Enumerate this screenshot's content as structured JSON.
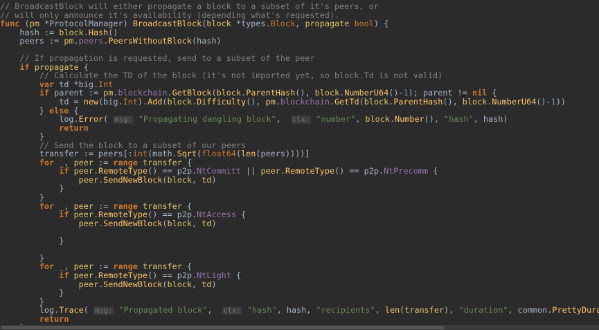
{
  "editor": {
    "language": "go",
    "token_colors": {
      "comment": "#808080",
      "keyword": "#cc7832",
      "function": "#ffc66d",
      "parameter": "#e0c46c",
      "field": "#9876aa",
      "string": "#6a8759",
      "number": "#6897bb",
      "default": "#a9b7c6",
      "background": "#2b2b2b"
    },
    "lines": [
      [
        {
          "t": "com",
          "v": "// BroadcastBlock will either propagate a block to a subset of it's peers, or"
        }
      ],
      [
        {
          "t": "com",
          "v": "// will only announce it's availability (depending what's requested)."
        }
      ],
      [
        {
          "t": "kw",
          "v": "func"
        },
        {
          "t": "op",
          "v": " ("
        },
        {
          "t": "param",
          "v": "pm"
        },
        {
          "t": "op",
          "v": " *ProtocolManager) "
        },
        {
          "t": "fn",
          "v": "BroadcastBlock"
        },
        {
          "t": "op",
          "v": "("
        },
        {
          "t": "param",
          "v": "block"
        },
        {
          "t": "op",
          "v": " *types."
        },
        {
          "t": "type",
          "v": "Block"
        },
        {
          "t": "op",
          "v": ", "
        },
        {
          "t": "param",
          "v": "propagate"
        },
        {
          "t": "op",
          "v": " "
        },
        {
          "t": "type",
          "v": "bool"
        },
        {
          "t": "op",
          "v": ") {"
        }
      ],
      [
        {
          "t": "op",
          "v": "    hash := "
        },
        {
          "t": "param",
          "v": "block"
        },
        {
          "t": "op",
          "v": "."
        },
        {
          "t": "fn",
          "v": "Hash"
        },
        {
          "t": "op",
          "v": "()"
        }
      ],
      [
        {
          "t": "op",
          "v": "    peers := "
        },
        {
          "t": "param",
          "v": "pm"
        },
        {
          "t": "op",
          "v": "."
        },
        {
          "t": "field",
          "v": "peers"
        },
        {
          "t": "op",
          "v": "."
        },
        {
          "t": "fn",
          "v": "PeersWithoutBlock"
        },
        {
          "t": "op",
          "v": "(hash)"
        }
      ],
      [
        {
          "t": "op",
          "v": ""
        }
      ],
      [
        {
          "t": "com",
          "v": "    // If propagation is requested, send to a subset of the peer"
        }
      ],
      [
        {
          "t": "op",
          "v": "    "
        },
        {
          "t": "kw",
          "v": "if"
        },
        {
          "t": "op",
          "v": " "
        },
        {
          "t": "param",
          "v": "propagate"
        },
        {
          "t": "op",
          "v": " {"
        }
      ],
      [
        {
          "t": "com",
          "v": "        // Calculate the TD of the block (it's not imported yet, so block.Td is not valid)"
        }
      ],
      [
        {
          "t": "op",
          "v": "        "
        },
        {
          "t": "kw",
          "v": "var"
        },
        {
          "t": "op",
          "v": " td *big."
        },
        {
          "t": "type",
          "v": "Int"
        }
      ],
      [
        {
          "t": "op",
          "v": "        "
        },
        {
          "t": "kw",
          "v": "if"
        },
        {
          "t": "op",
          "v": " parent := "
        },
        {
          "t": "param",
          "v": "pm"
        },
        {
          "t": "op",
          "v": "."
        },
        {
          "t": "field",
          "v": "blockchain"
        },
        {
          "t": "op",
          "v": "."
        },
        {
          "t": "fn",
          "v": "GetBlock"
        },
        {
          "t": "op",
          "v": "("
        },
        {
          "t": "param",
          "v": "block"
        },
        {
          "t": "op",
          "v": "."
        },
        {
          "t": "fn",
          "v": "ParentHash"
        },
        {
          "t": "op",
          "v": "(), "
        },
        {
          "t": "param",
          "v": "block"
        },
        {
          "t": "op",
          "v": "."
        },
        {
          "t": "fn",
          "v": "NumberU64"
        },
        {
          "t": "op",
          "v": "()-"
        },
        {
          "t": "num",
          "v": "1"
        },
        {
          "t": "op",
          "v": "); parent != "
        },
        {
          "t": "kw",
          "v": "nil"
        },
        {
          "t": "op",
          "v": " {"
        }
      ],
      [
        {
          "t": "op",
          "v": "            td = "
        },
        {
          "t": "fn",
          "v": "new"
        },
        {
          "t": "op",
          "v": "(big."
        },
        {
          "t": "type",
          "v": "Int"
        },
        {
          "t": "op",
          "v": ")."
        },
        {
          "t": "fn",
          "v": "Add"
        },
        {
          "t": "op",
          "v": "("
        },
        {
          "t": "param",
          "v": "block"
        },
        {
          "t": "op",
          "v": "."
        },
        {
          "t": "fn",
          "v": "Difficulty"
        },
        {
          "t": "op",
          "v": "(), "
        },
        {
          "t": "param",
          "v": "pm"
        },
        {
          "t": "op",
          "v": "."
        },
        {
          "t": "field",
          "v": "blockchain"
        },
        {
          "t": "op",
          "v": "."
        },
        {
          "t": "fn",
          "v": "GetTd"
        },
        {
          "t": "op",
          "v": "("
        },
        {
          "t": "param",
          "v": "block"
        },
        {
          "t": "op",
          "v": "."
        },
        {
          "t": "fn",
          "v": "ParentHash"
        },
        {
          "t": "op",
          "v": "(), "
        },
        {
          "t": "param",
          "v": "block"
        },
        {
          "t": "op",
          "v": "."
        },
        {
          "t": "fn",
          "v": "NumberU64"
        },
        {
          "t": "op",
          "v": "()-"
        },
        {
          "t": "num",
          "v": "1"
        },
        {
          "t": "op",
          "v": "))"
        }
      ],
      [
        {
          "t": "op",
          "v": "        } "
        },
        {
          "t": "kw",
          "v": "else"
        },
        {
          "t": "op",
          "v": " {"
        }
      ],
      [
        {
          "t": "op",
          "v": "            log."
        },
        {
          "t": "fn",
          "v": "Error"
        },
        {
          "t": "op",
          "v": "( "
        },
        {
          "t": "hint",
          "v": "msg:"
        },
        {
          "t": "op",
          "v": " "
        },
        {
          "t": "str",
          "v": "\"Propagating dangling block\""
        },
        {
          "t": "op",
          "v": ",  "
        },
        {
          "t": "hint",
          "v": "ctx:"
        },
        {
          "t": "op",
          "v": " "
        },
        {
          "t": "str",
          "v": "\"number\""
        },
        {
          "t": "op",
          "v": ", "
        },
        {
          "t": "param",
          "v": "block"
        },
        {
          "t": "op",
          "v": "."
        },
        {
          "t": "fn",
          "v": "Number"
        },
        {
          "t": "op",
          "v": "(), "
        },
        {
          "t": "str",
          "v": "\"hash\""
        },
        {
          "t": "op",
          "v": ", hash)"
        }
      ],
      [
        {
          "t": "op",
          "v": "            "
        },
        {
          "t": "kw",
          "v": "return"
        }
      ],
      [
        {
          "t": "op",
          "v": "        }"
        }
      ],
      [
        {
          "t": "com",
          "v": "        // Send the block to a subset of our peers"
        }
      ],
      [
        {
          "t": "op",
          "v": "        transfer := peers[:"
        },
        {
          "t": "type",
          "v": "int"
        },
        {
          "t": "op",
          "v": "(math."
        },
        {
          "t": "fn",
          "v": "Sqrt"
        },
        {
          "t": "op",
          "v": "("
        },
        {
          "t": "type",
          "v": "float64"
        },
        {
          "t": "op",
          "v": "("
        },
        {
          "t": "fn",
          "v": "len"
        },
        {
          "t": "op",
          "v": "(peers))))]"
        }
      ],
      [
        {
          "t": "op",
          "v": "        "
        },
        {
          "t": "kw",
          "v": "for"
        },
        {
          "t": "op",
          "v": " _, "
        },
        {
          "t": "param",
          "v": "peer"
        },
        {
          "t": "op",
          "v": " := "
        },
        {
          "t": "kw",
          "v": "range"
        },
        {
          "t": "op",
          "v": " "
        },
        {
          "t": "param",
          "v": "transfer"
        },
        {
          "t": "op",
          "v": " {"
        }
      ],
      [
        {
          "t": "op",
          "v": "            "
        },
        {
          "t": "kw",
          "v": "if"
        },
        {
          "t": "op",
          "v": " "
        },
        {
          "t": "param",
          "v": "peer"
        },
        {
          "t": "op",
          "v": "."
        },
        {
          "t": "fn",
          "v": "RemoteType"
        },
        {
          "t": "op",
          "v": "() == p2p."
        },
        {
          "t": "pkgc",
          "v": "NtCommitt"
        },
        {
          "t": "op",
          "v": " || "
        },
        {
          "t": "param",
          "v": "peer"
        },
        {
          "t": "op",
          "v": "."
        },
        {
          "t": "fn",
          "v": "RemoteType"
        },
        {
          "t": "op",
          "v": "() == p2p."
        },
        {
          "t": "pkgc",
          "v": "NtPrecomm"
        },
        {
          "t": "op",
          "v": " {"
        }
      ],
      [
        {
          "t": "op",
          "v": "                "
        },
        {
          "t": "param",
          "v": "peer"
        },
        {
          "t": "op",
          "v": "."
        },
        {
          "t": "fn",
          "v": "SendNewBlock"
        },
        {
          "t": "op",
          "v": "("
        },
        {
          "t": "param",
          "v": "block"
        },
        {
          "t": "op",
          "v": ", "
        },
        {
          "t": "param",
          "v": "td"
        },
        {
          "t": "op",
          "v": ")"
        }
      ],
      [
        {
          "t": "op",
          "v": "            }"
        }
      ],
      [
        {
          "t": "op",
          "v": "        }"
        }
      ],
      [
        {
          "t": "op",
          "v": "        "
        },
        {
          "t": "kw",
          "v": "for"
        },
        {
          "t": "op",
          "v": " _, "
        },
        {
          "t": "param",
          "v": "peer"
        },
        {
          "t": "op",
          "v": " := "
        },
        {
          "t": "kw",
          "v": "range"
        },
        {
          "t": "op",
          "v": " "
        },
        {
          "t": "param",
          "v": "transfer"
        },
        {
          "t": "op",
          "v": " {"
        }
      ],
      [
        {
          "t": "op",
          "v": "            "
        },
        {
          "t": "kw",
          "v": "if"
        },
        {
          "t": "op",
          "v": " "
        },
        {
          "t": "param",
          "v": "peer"
        },
        {
          "t": "op",
          "v": "."
        },
        {
          "t": "fn",
          "v": "RemoteType"
        },
        {
          "t": "op",
          "v": "() == p2p."
        },
        {
          "t": "pkgc",
          "v": "NtAccess"
        },
        {
          "t": "op",
          "v": " {"
        }
      ],
      [
        {
          "t": "op",
          "v": "                "
        },
        {
          "t": "param",
          "v": "peer"
        },
        {
          "t": "op",
          "v": "."
        },
        {
          "t": "fn",
          "v": "SendNewBlock"
        },
        {
          "t": "op",
          "v": "("
        },
        {
          "t": "param",
          "v": "block"
        },
        {
          "t": "op",
          "v": ", "
        },
        {
          "t": "param",
          "v": "td"
        },
        {
          "t": "op",
          "v": ")"
        }
      ],
      [
        {
          "t": "op",
          "v": ""
        }
      ],
      [
        {
          "t": "op",
          "v": "            }"
        }
      ],
      [
        {
          "t": "op",
          "v": ""
        }
      ],
      [
        {
          "t": "op",
          "v": "        }"
        }
      ],
      [
        {
          "t": "op",
          "v": "        "
        },
        {
          "t": "kw",
          "v": "for"
        },
        {
          "t": "op",
          "v": " _, "
        },
        {
          "t": "param",
          "v": "peer"
        },
        {
          "t": "op",
          "v": " := "
        },
        {
          "t": "kw",
          "v": "range"
        },
        {
          "t": "op",
          "v": " "
        },
        {
          "t": "param",
          "v": "transfer"
        },
        {
          "t": "op",
          "v": " {"
        }
      ],
      [
        {
          "t": "op",
          "v": "            "
        },
        {
          "t": "kw",
          "v": "if"
        },
        {
          "t": "op",
          "v": " "
        },
        {
          "t": "param",
          "v": "peer"
        },
        {
          "t": "op",
          "v": "."
        },
        {
          "t": "fn",
          "v": "RemoteType"
        },
        {
          "t": "op",
          "v": "() == p2p."
        },
        {
          "t": "pkgc",
          "v": "NtLight"
        },
        {
          "t": "op",
          "v": " {"
        }
      ],
      [
        {
          "t": "op",
          "v": "                "
        },
        {
          "t": "param",
          "v": "peer"
        },
        {
          "t": "op",
          "v": "."
        },
        {
          "t": "fn",
          "v": "SendNewBlock"
        },
        {
          "t": "op",
          "v": "("
        },
        {
          "t": "param",
          "v": "block"
        },
        {
          "t": "op",
          "v": ", "
        },
        {
          "t": "param",
          "v": "td"
        },
        {
          "t": "op",
          "v": ")"
        }
      ],
      [
        {
          "t": "op",
          "v": "            }"
        }
      ],
      [
        {
          "t": "op",
          "v": "        }"
        }
      ],
      [
        {
          "t": "op",
          "v": "        log."
        },
        {
          "t": "fn",
          "v": "Trace"
        },
        {
          "t": "op",
          "v": "( "
        },
        {
          "t": "hint",
          "v": "msg:"
        },
        {
          "t": "op",
          "v": " "
        },
        {
          "t": "str",
          "v": "\"Propagated block\""
        },
        {
          "t": "op",
          "v": ",  "
        },
        {
          "t": "hint",
          "v": "ctx:"
        },
        {
          "t": "op",
          "v": " "
        },
        {
          "t": "str",
          "v": "\"hash\""
        },
        {
          "t": "op",
          "v": ", hash, "
        },
        {
          "t": "str",
          "v": "\"recipients\""
        },
        {
          "t": "op",
          "v": ", "
        },
        {
          "t": "fn",
          "v": "len"
        },
        {
          "t": "op",
          "v": "("
        },
        {
          "t": "param",
          "v": "transfer"
        },
        {
          "t": "op",
          "v": "), "
        },
        {
          "t": "str",
          "v": "\"duration\""
        },
        {
          "t": "op",
          "v": ", common."
        },
        {
          "t": "fn",
          "v": "PrettyDuration"
        }
      ],
      [
        {
          "t": "op",
          "v": "        "
        },
        {
          "t": "kw",
          "v": "return"
        }
      ],
      [
        {
          "t": "op",
          "v": "    }"
        }
      ]
    ]
  }
}
